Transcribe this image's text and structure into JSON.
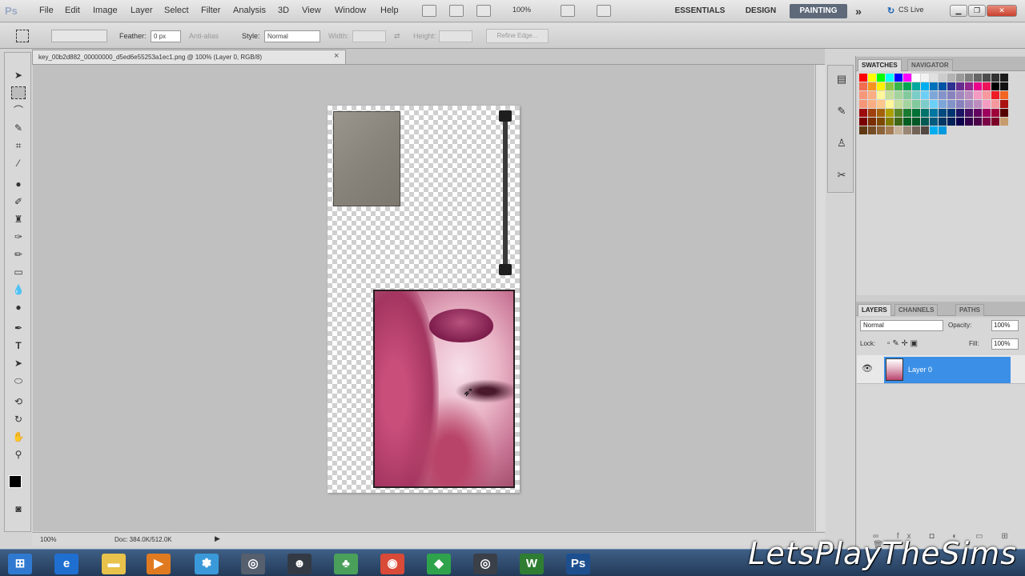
{
  "app": {
    "logo": "Ps"
  },
  "menu": [
    "File",
    "Edit",
    "Image",
    "Layer",
    "Select",
    "Filter",
    "Analysis",
    "3D",
    "View",
    "Window",
    "Help"
  ],
  "zoom_level": "100%",
  "workspaces": [
    "ESSENTIALS",
    "DESIGN",
    "PAINTING"
  ],
  "active_workspace": "PAINTING",
  "more_label": "»",
  "cs_live": "CS Live",
  "options": {
    "feather_label": "Feather:",
    "feather_value": "0 px",
    "antialias_label": "Anti-alias",
    "style_label": "Style:",
    "style_value": "Normal",
    "width_label": "Width:",
    "height_label": "Height:",
    "refine_edge": "Refine Edge..."
  },
  "document": {
    "tab_title": "key_00b2d882_00000000_d5ed6e55253a1ec1.png @ 100% (Layer 0, RGB/8)",
    "close": "×"
  },
  "status": {
    "zoom": "100%",
    "doc_info": "Doc: 384.0K/512.0K"
  },
  "panels": {
    "swatches_tab": "SWATCHES",
    "navigator_tab": "NAVIGATOR",
    "layers_tab": "LAYERS",
    "channels_tab": "CHANNELS",
    "paths_tab": "PATHS",
    "blend_mode": "Normal",
    "opacity_label": "Opacity:",
    "opacity_value": "100%",
    "lock_label": "Lock:",
    "fill_label": "Fill:",
    "fill_value": "100%",
    "layer_name": "Layer 0"
  },
  "swatch_colors": [
    "#ff0000",
    "#ffff00",
    "#00ff00",
    "#00ffff",
    "#0000ff",
    "#ff00ff",
    "#ffffff",
    "#f2f2f2",
    "#e0e0e0",
    "#cccccc",
    "#b3b3b3",
    "#999999",
    "#808080",
    "#666666",
    "#4d4d4d",
    "#333333",
    "#1a1a1a",
    "#f26c4f",
    "#f7941d",
    "#fff200",
    "#8dc63f",
    "#39b54a",
    "#00a651",
    "#00a99d",
    "#00aeef",
    "#0072bc",
    "#0054a6",
    "#2e3192",
    "#662d91",
    "#92278f",
    "#ec008c",
    "#ed145b",
    "#000000",
    "#111111",
    "#f7977a",
    "#fbad82",
    "#fff79a",
    "#c4df9b",
    "#a3d39c",
    "#82ca9d",
    "#7bcdc8",
    "#6ecff6",
    "#7ea7d8",
    "#8493ca",
    "#8882be",
    "#a187be",
    "#bc8dbf",
    "#f49ac2",
    "#f6989d",
    "#ed1c24",
    "#f26522",
    "#f69679",
    "#f9ad81",
    "#fdc68a",
    "#fff799",
    "#c6df9c",
    "#a4d49d",
    "#81ca9d",
    "#7bcdc9",
    "#6ccff7",
    "#7ca6d8",
    "#8293ca",
    "#8881be",
    "#a286bd",
    "#bc8cbf",
    "#f49bc1",
    "#f5989d",
    "#aa1111",
    "#9e0b0f",
    "#a0410d",
    "#a3620a",
    "#aba000",
    "#598527",
    "#197b30",
    "#007236",
    "#00746b",
    "#0076a3",
    "#004a80",
    "#003471",
    "#1b1464",
    "#440e62",
    "#630460",
    "#9e005d",
    "#9e0039",
    "#550000",
    "#790000",
    "#7b2e00",
    "#7d4900",
    "#827b00",
    "#406618",
    "#005e20",
    "#005826",
    "#005952",
    "#005b7f",
    "#003663",
    "#002157",
    "#0d004c",
    "#32004b",
    "#4b0049",
    "#7b0046",
    "#7a0026",
    "#c69c6d",
    "#603913",
    "#754c24",
    "#8c6239",
    "#a67c52",
    "#c7b299",
    "#998675",
    "#736357",
    "#534741",
    "#00aeef",
    "#0099dd"
  ],
  "taskbar_apps": [
    {
      "name": "start",
      "glyph": "⊞",
      "color": "#2f7ad0"
    },
    {
      "name": "internet-explorer",
      "glyph": "e",
      "color": "#1f6fd1"
    },
    {
      "name": "folder",
      "glyph": "▬",
      "color": "#e8c24a"
    },
    {
      "name": "media-player",
      "glyph": "▶",
      "color": "#e07a20"
    },
    {
      "name": "messenger",
      "glyph": "✽",
      "color": "#3a9ad9"
    },
    {
      "name": "mail",
      "glyph": "◎",
      "color": "#555f6d"
    },
    {
      "name": "runner",
      "glyph": "☻",
      "color": "#333a44"
    },
    {
      "name": "people",
      "glyph": "♣",
      "color": "#4aa05a"
    },
    {
      "name": "chrome",
      "glyph": "◉",
      "color": "#d94a38"
    },
    {
      "name": "sims",
      "glyph": "◆",
      "color": "#2fa34b"
    },
    {
      "name": "record",
      "glyph": "◎",
      "color": "#3a3f48"
    },
    {
      "name": "word",
      "glyph": "W",
      "color": "#2e7d32"
    },
    {
      "name": "photoshop",
      "glyph": "Ps",
      "color": "#1d4f8f"
    }
  ],
  "watermark": "LetsPlayTheSims"
}
